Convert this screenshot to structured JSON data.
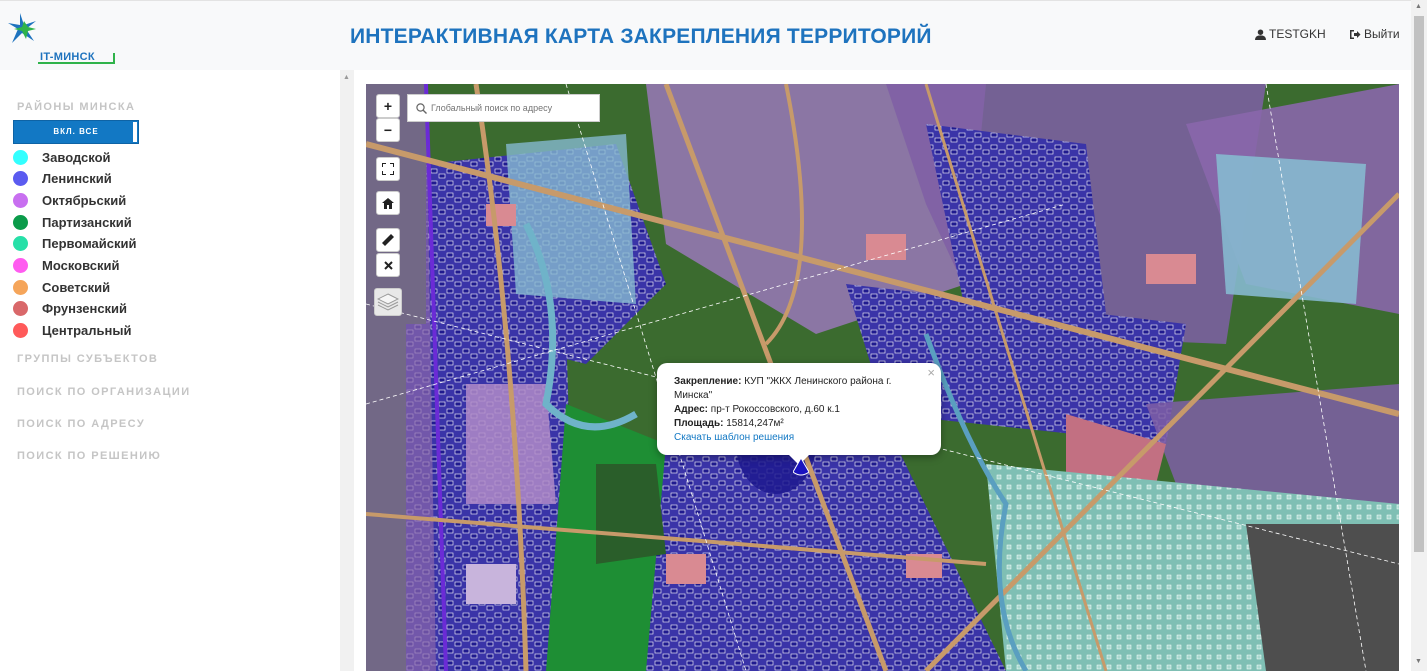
{
  "header": {
    "logo_text": "IT-МИНСК",
    "title": "ИНТЕРАКТИВНАЯ КАРТА ЗАКРЕПЛЕНИЯ ТЕРРИТОРИЙ",
    "user": "TESTGKH",
    "logout": "Выйти"
  },
  "sidebar": {
    "districts_title": "РАЙОНЫ МИНСКА",
    "toggle_all": "ВКЛ. ВСЕ",
    "districts": [
      {
        "name": "Заводской",
        "color": "#33ffff"
      },
      {
        "name": "Ленинский",
        "color": "#5b5bf0"
      },
      {
        "name": "Октябрьский",
        "color": "#c86ff0"
      },
      {
        "name": "Партизанский",
        "color": "#0b9b4a"
      },
      {
        "name": "Первомайский",
        "color": "#27e0a8"
      },
      {
        "name": "Московский",
        "color": "#ff5cf0"
      },
      {
        "name": "Советский",
        "color": "#f5a55a"
      },
      {
        "name": "Фрунзенский",
        "color": "#d9686a"
      },
      {
        "name": "Центральный",
        "color": "#ff5a5a"
      }
    ],
    "groups": "ГРУППЫ СУБЪЕКТОВ",
    "search_org": "ПОИСК ПО ОРГАНИЗАЦИИ",
    "search_address": "ПОИСК ПО АДРЕСУ",
    "search_decision": "ПОИСК ПО РЕШЕНИЮ"
  },
  "map": {
    "search_placeholder": "Глобальный поиск по адресу",
    "zoom_in": "+",
    "zoom_out": "−",
    "icons": [
      "fullscreen-icon",
      "home-icon",
      "ruler-icon",
      "close-icon",
      "layers-icon"
    ]
  },
  "popup": {
    "assign_label": "Закрепление:",
    "assign_value": "КУП \"ЖКХ Ленинского района г. Минска\"",
    "address_label": "Адрес:",
    "address_value": "пр-т Рокоссовского, д.60 к.1",
    "area_label": "Площадь:",
    "area_value": "15814,247м²",
    "link": "Скачать шаблон решения",
    "close": "×"
  }
}
